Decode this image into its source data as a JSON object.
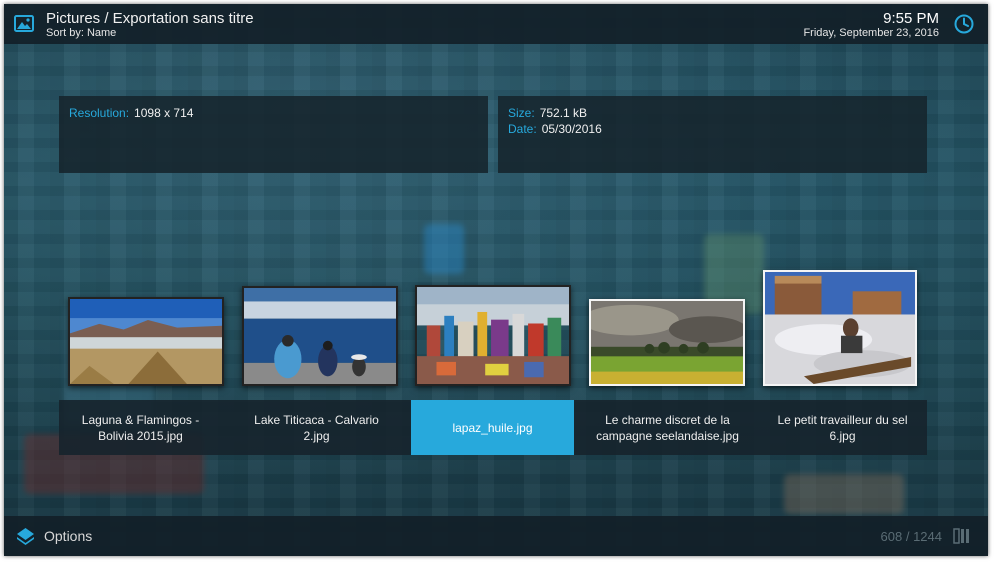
{
  "header": {
    "title": "Pictures / Exportation sans titre",
    "sort": "Sort by: Name",
    "time": "9:55 PM",
    "date": "Friday, September 23, 2016"
  },
  "info_left": {
    "resolution_key": "Resolution:",
    "resolution_value": "1098 x 714"
  },
  "info_right": {
    "size_key": "Size:",
    "size_value": "752.1 kB",
    "date_key": "Date:",
    "date_value": "05/30/2016"
  },
  "items": [
    {
      "label": "Laguna & Flamingos - Bolivia 2015.jpg",
      "selected": false
    },
    {
      "label": "Lake Titicaca - Calvario 2.jpg",
      "selected": false
    },
    {
      "label": "lapaz_huile.jpg",
      "selected": true
    },
    {
      "label": "Le charme discret de la campagne seelandaise.jpg",
      "selected": false
    },
    {
      "label": "Le petit travailleur du sel 6.jpg",
      "selected": false
    }
  ],
  "footer": {
    "options": "Options",
    "counter": "608 / 1244"
  },
  "icons": {
    "app": "pictures-icon",
    "clock": "clock-icon",
    "options": "options-icon",
    "view": "list-view-icon"
  },
  "colors": {
    "accent": "#27a9dc",
    "bar": "#12202a",
    "panel": "#16242c"
  }
}
